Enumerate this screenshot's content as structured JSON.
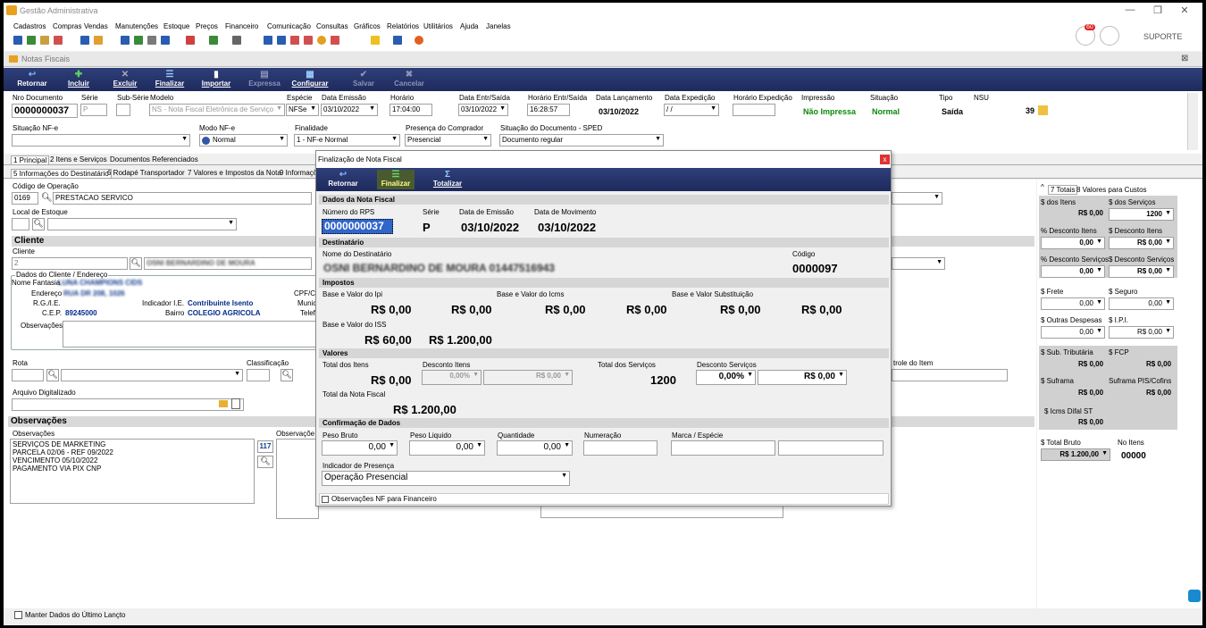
{
  "app": {
    "title": "Gestão Administrativa",
    "support": "SUPORTE",
    "notif_badge": "60"
  },
  "menu": [
    "Cadastros",
    "Compras",
    "Vendas",
    "Manutenções",
    "Estoque",
    "Preços",
    "Financeiro",
    "Comunicação",
    "Consultas",
    "Gráficos",
    "Relatórios",
    "Utilitários",
    "Ajuda",
    "Janelas"
  ],
  "window": {
    "title": "Notas Fiscais",
    "close": "⊠"
  },
  "actions": [
    {
      "label": "Retornar"
    },
    {
      "label": "Incluir"
    },
    {
      "label": "Excluir"
    },
    {
      "label": "Finalizar"
    },
    {
      "label": "Importar"
    },
    {
      "label": "Expressa"
    },
    {
      "label": "Configurar"
    },
    {
      "label": "Salvar"
    },
    {
      "label": "Cancelar"
    }
  ],
  "header": {
    "nro_documento_label": "Nro Documento",
    "nro_documento": "0000000037",
    "serie_label": "Série",
    "serie": "P",
    "subserie_label": "Sub-Série",
    "modelo_label": "Modelo",
    "modelo": "NS - Nota Fiscal Eletrônica de Serviço",
    "especie_label": "Espécie",
    "especie": "NFSe",
    "data_emissao_label": "Data Emissão",
    "data_emissao": "03/10/2022",
    "horario_label": "Horário",
    "horario": "17:04:00",
    "data_entr_label": "Data Entr/Saída",
    "data_entr": "03/10/2022",
    "horario_entr_label": "Horário Entr/Saída",
    "horario_entr": "16:28:57",
    "data_lanc_label": "Data Lançamento",
    "data_lanc": "03/10/2022",
    "data_exp_label": "Data Expedição",
    "data_exp": " / /",
    "horario_exp_label": "Horário Expedição",
    "impressao_label": "Impressão",
    "impressao": "Não Impressa",
    "situacao_label": "Situação",
    "situacao": "Normal",
    "tipo_label": "Tipo",
    "tipo": "Saída",
    "nsu_label": "NSU",
    "nsu": "39",
    "situacao_nfe_label": "Situação NF-e",
    "modo_nfe_label": "Modo NF-e",
    "modo_nfe": "Normal",
    "finalidade_label": "Finalidade",
    "finalidade": "1 - NF-e Normal",
    "presenca_label": "Presença do Comprador",
    "presenca": "Presencial",
    "sit_doc_label": "Situação do Documento - SPED",
    "sit_doc": "Documento regular"
  },
  "tabs1": [
    "1 Principal",
    "2 Itens e Serviços",
    "Documentos Referenciados"
  ],
  "tabs2": [
    "5 Informações do Destinatário",
    "6 Rodapé Transportador",
    "7 Valores e Impostos da Nota",
    "9 Informaçõ"
  ],
  "left": {
    "cod_operacao_label": "Código de Operação",
    "cod_operacao": "0169",
    "cod_operacao_desc": "PRESTACAO SERVICO",
    "local_estoque_label": "Local de Estoque",
    "cliente_section": "Cliente",
    "cliente_label": "Cliente",
    "cliente_code": "2",
    "cliente_name": "OSNI BERNARDINO DE MOURA",
    "dados_cliente": "Dados do Cliente / Endereço",
    "nome_fantasia_label": "Nome Fantasia",
    "nome_fantasia": "LUNA CHAMPIONS CIDS",
    "endereco_label": "Endereço",
    "endereco": "RUA DR 208, 1026",
    "rg_label": "R.G./I.E.",
    "ind_ie_label": "Indicador I.E.",
    "ind_ie": "Contribuinte Isento",
    "cpf_label": "CPF/CN",
    "munic_label": "Municip",
    "telef_label": "Telefo",
    "cep_label": "C.E.P.",
    "cep": "89245000",
    "bairro_label": "Bairro",
    "bairro": "COLEGIO AGRICOLA",
    "observacoes_label": "Observações",
    "rota_label": "Rota",
    "classificacao_label": "Classificação",
    "arquivo_label": "Arquivo Digitalizado",
    "obs_section": "Observações",
    "obs_label": "Observações",
    "obs_label2": "Observaçõe",
    "obs_text": [
      "SERVIÇOS DE MARKETING",
      "PARCELA 02/06 - REF 09/2022",
      "VENCIMENTO 05/10/2022",
      "PAGAMENTO VIA PIX CNP"
    ],
    "obs_counter": "117",
    "controle_label": "trole do Item",
    "manter": "Manter Dados do Último Lançto"
  },
  "modal": {
    "title": "Finalização de Nota Fiscal",
    "btn_retornar": "Retornar",
    "btn_finalizar": "Finalizar",
    "btn_totalizar": "Totalizar",
    "dados_hdr": "Dados da Nota Fiscal",
    "rps_label": "Número do RPS",
    "rps": "0000000037",
    "serie_label": "Série",
    "serie": "P",
    "emissao_label": "Data de Emissão",
    "emissao": "03/10/2022",
    "movimento_label": "Data de Movimento",
    "movimento": "03/10/2022",
    "dest_hdr": "Destinatário",
    "dest_nome_label": "Nome do Destinatário",
    "dest_nome": "OSNI BERNARDINO DE MOURA 01447516943",
    "codigo_label": "Código",
    "codigo": "0000097",
    "impostos_hdr": "Impostos",
    "ipi_label": "Base e Valor do Ipi",
    "icms_label": "Base e Valor do Icms",
    "st_label": "Base e Valor Substituição",
    "ipi_base": "R$ 0,00",
    "ipi_valor": "R$ 0,00",
    "icms_base": "R$ 0,00",
    "icms_valor": "R$ 0,00",
    "st_base": "R$ 0,00",
    "st_valor": "R$ 0,00",
    "iss_label": "Base e Valor do ISS",
    "iss_base": "R$ 60,00",
    "iss_valor": "R$ 1.200,00",
    "valores_hdr": "Valores",
    "total_itens_label": "Total dos Itens",
    "total_itens": "R$ 0,00",
    "desc_itens_label": "Desconto Itens",
    "desc_itens_pct": "0,00%",
    "desc_itens_val": "R$ 0,00",
    "total_serv_label": "Total dos Serviços",
    "total_serv": "1200",
    "desc_serv_label": "Desconto Serviços",
    "desc_serv_pct": "0,00%",
    "desc_serv_val": "R$ 0,00",
    "total_nota_label": "Total da Nota Fiscal",
    "total_nota": "R$ 1.200,00",
    "conf_hdr": "Confirmação de Dados",
    "peso_bruto_label": "Peso Bruto",
    "peso_bruto": "0,00",
    "peso_liq_label": "Peso Liquido",
    "peso_liq": "0,00",
    "qtd_label": "Quantidade",
    "qtd": "0,00",
    "numeracao_label": "Numeração",
    "marca_label": "Marca / Espécie",
    "ind_pres_label": "Indicador de Presença",
    "ind_pres": "Operação Presencial",
    "obs_fin": "Observações NF para Financeiro"
  },
  "totals": {
    "tab1": "7 Totais",
    "tab2": "8 Valores para Custos",
    "itens_label": "$ dos Itens",
    "itens": "R$ 0,00",
    "servicos_label": "$ dos Serviços",
    "servicos": "1200",
    "desc_itens_pct_label": "% Desconto Itens",
    "desc_itens_pct": "0,00",
    "desc_itens_label": "$ Desconto Itens",
    "desc_itens": "R$ 0,00",
    "desc_serv_pct_label": "% Desconto Serviços",
    "desc_serv_pct": "0,00",
    "desc_serv_label": "$ Desconto Serviços",
    "desc_serv": "R$ 0,00",
    "frete_label": "$ Frete",
    "frete": "0,00",
    "seguro_label": "$ Seguro",
    "seguro": "0,00",
    "outras_label": "$ Outras Despesas",
    "outras": "0,00",
    "ipi_label": "$ I.P.I.",
    "ipi": "R$ 0,00",
    "st_label": "$ Sub. Tributária",
    "st": "R$ 0,00",
    "fcp_label": "$ FCP",
    "fcp": "R$ 0,00",
    "suframa_label": "$ Suframa",
    "suframa": "R$ 0,00",
    "pis_label": "Suframa PIS/Cofins",
    "pis": "R$ 0,00",
    "difal_label": "$ Icms Difal ST",
    "difal": "R$ 0,00",
    "bruto_label": "$ Total Bruto",
    "bruto": "R$ 1.200,00",
    "noitens_label": "No Itens",
    "noitens": "00000"
  }
}
